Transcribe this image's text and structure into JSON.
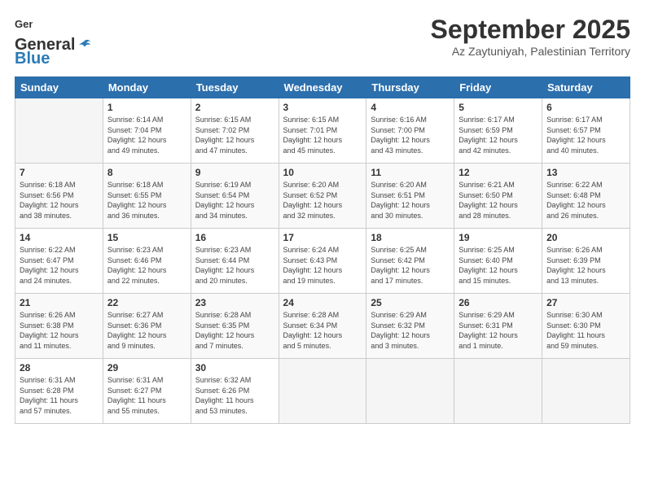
{
  "logo": {
    "line1": "General",
    "line2": "Blue"
  },
  "title": "September 2025",
  "location": "Az Zaytuniyah, Palestinian Territory",
  "days_header": [
    "Sunday",
    "Monday",
    "Tuesday",
    "Wednesday",
    "Thursday",
    "Friday",
    "Saturday"
  ],
  "weeks": [
    [
      {
        "day": "",
        "text": ""
      },
      {
        "day": "1",
        "text": "Sunrise: 6:14 AM\nSunset: 7:04 PM\nDaylight: 12 hours\nand 49 minutes."
      },
      {
        "day": "2",
        "text": "Sunrise: 6:15 AM\nSunset: 7:02 PM\nDaylight: 12 hours\nand 47 minutes."
      },
      {
        "day": "3",
        "text": "Sunrise: 6:15 AM\nSunset: 7:01 PM\nDaylight: 12 hours\nand 45 minutes."
      },
      {
        "day": "4",
        "text": "Sunrise: 6:16 AM\nSunset: 7:00 PM\nDaylight: 12 hours\nand 43 minutes."
      },
      {
        "day": "5",
        "text": "Sunrise: 6:17 AM\nSunset: 6:59 PM\nDaylight: 12 hours\nand 42 minutes."
      },
      {
        "day": "6",
        "text": "Sunrise: 6:17 AM\nSunset: 6:57 PM\nDaylight: 12 hours\nand 40 minutes."
      }
    ],
    [
      {
        "day": "7",
        "text": "Sunrise: 6:18 AM\nSunset: 6:56 PM\nDaylight: 12 hours\nand 38 minutes."
      },
      {
        "day": "8",
        "text": "Sunrise: 6:18 AM\nSunset: 6:55 PM\nDaylight: 12 hours\nand 36 minutes."
      },
      {
        "day": "9",
        "text": "Sunrise: 6:19 AM\nSunset: 6:54 PM\nDaylight: 12 hours\nand 34 minutes."
      },
      {
        "day": "10",
        "text": "Sunrise: 6:20 AM\nSunset: 6:52 PM\nDaylight: 12 hours\nand 32 minutes."
      },
      {
        "day": "11",
        "text": "Sunrise: 6:20 AM\nSunset: 6:51 PM\nDaylight: 12 hours\nand 30 minutes."
      },
      {
        "day": "12",
        "text": "Sunrise: 6:21 AM\nSunset: 6:50 PM\nDaylight: 12 hours\nand 28 minutes."
      },
      {
        "day": "13",
        "text": "Sunrise: 6:22 AM\nSunset: 6:48 PM\nDaylight: 12 hours\nand 26 minutes."
      }
    ],
    [
      {
        "day": "14",
        "text": "Sunrise: 6:22 AM\nSunset: 6:47 PM\nDaylight: 12 hours\nand 24 minutes."
      },
      {
        "day": "15",
        "text": "Sunrise: 6:23 AM\nSunset: 6:46 PM\nDaylight: 12 hours\nand 22 minutes."
      },
      {
        "day": "16",
        "text": "Sunrise: 6:23 AM\nSunset: 6:44 PM\nDaylight: 12 hours\nand 20 minutes."
      },
      {
        "day": "17",
        "text": "Sunrise: 6:24 AM\nSunset: 6:43 PM\nDaylight: 12 hours\nand 19 minutes."
      },
      {
        "day": "18",
        "text": "Sunrise: 6:25 AM\nSunset: 6:42 PM\nDaylight: 12 hours\nand 17 minutes."
      },
      {
        "day": "19",
        "text": "Sunrise: 6:25 AM\nSunset: 6:40 PM\nDaylight: 12 hours\nand 15 minutes."
      },
      {
        "day": "20",
        "text": "Sunrise: 6:26 AM\nSunset: 6:39 PM\nDaylight: 12 hours\nand 13 minutes."
      }
    ],
    [
      {
        "day": "21",
        "text": "Sunrise: 6:26 AM\nSunset: 6:38 PM\nDaylight: 12 hours\nand 11 minutes."
      },
      {
        "day": "22",
        "text": "Sunrise: 6:27 AM\nSunset: 6:36 PM\nDaylight: 12 hours\nand 9 minutes."
      },
      {
        "day": "23",
        "text": "Sunrise: 6:28 AM\nSunset: 6:35 PM\nDaylight: 12 hours\nand 7 minutes."
      },
      {
        "day": "24",
        "text": "Sunrise: 6:28 AM\nSunset: 6:34 PM\nDaylight: 12 hours\nand 5 minutes."
      },
      {
        "day": "25",
        "text": "Sunrise: 6:29 AM\nSunset: 6:32 PM\nDaylight: 12 hours\nand 3 minutes."
      },
      {
        "day": "26",
        "text": "Sunrise: 6:29 AM\nSunset: 6:31 PM\nDaylight: 12 hours\nand 1 minute."
      },
      {
        "day": "27",
        "text": "Sunrise: 6:30 AM\nSunset: 6:30 PM\nDaylight: 11 hours\nand 59 minutes."
      }
    ],
    [
      {
        "day": "28",
        "text": "Sunrise: 6:31 AM\nSunset: 6:28 PM\nDaylight: 11 hours\nand 57 minutes."
      },
      {
        "day": "29",
        "text": "Sunrise: 6:31 AM\nSunset: 6:27 PM\nDaylight: 11 hours\nand 55 minutes."
      },
      {
        "day": "30",
        "text": "Sunrise: 6:32 AM\nSunset: 6:26 PM\nDaylight: 11 hours\nand 53 minutes."
      },
      {
        "day": "",
        "text": ""
      },
      {
        "day": "",
        "text": ""
      },
      {
        "day": "",
        "text": ""
      },
      {
        "day": "",
        "text": ""
      }
    ]
  ]
}
